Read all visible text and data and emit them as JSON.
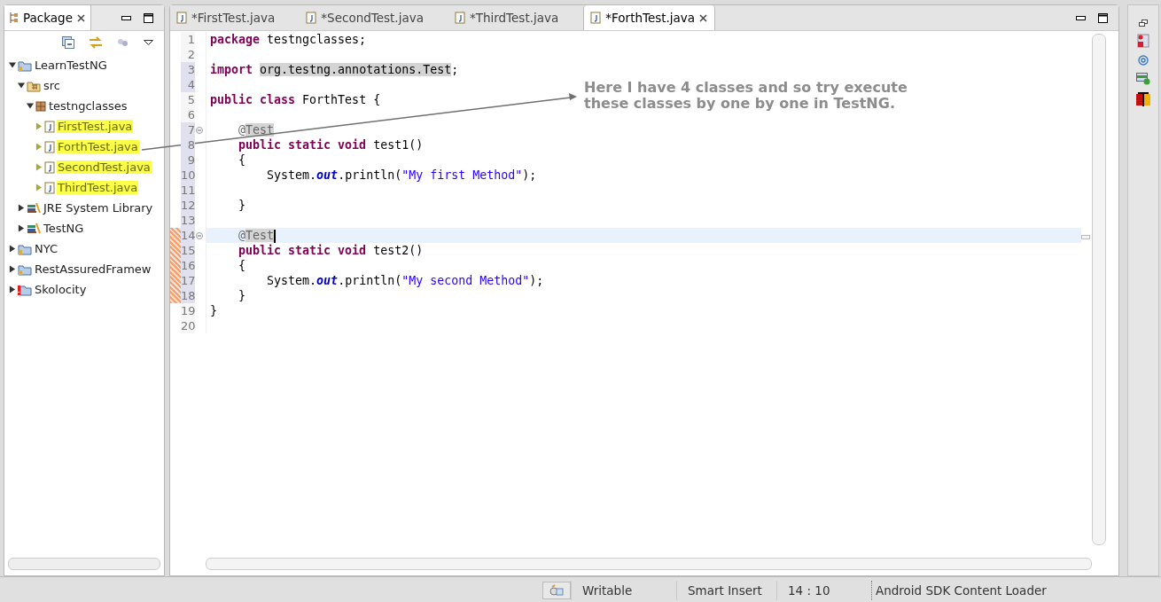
{
  "package_explorer": {
    "title": "Package",
    "tree": [
      {
        "label": "LearnTestNG",
        "kind": "project",
        "expanded": true,
        "children": [
          {
            "label": "src",
            "kind": "source-folder",
            "expanded": true,
            "children": [
              {
                "label": "testngclasses",
                "kind": "package",
                "expanded": true,
                "children": [
                  {
                    "label": "FirstTest.java",
                    "kind": "java-file",
                    "expanded": false,
                    "highlighted": true
                  },
                  {
                    "label": "ForthTest.java",
                    "kind": "java-file",
                    "expanded": false,
                    "highlighted": true
                  },
                  {
                    "label": "SecondTest.java",
                    "kind": "java-file",
                    "expanded": false,
                    "highlighted": true
                  },
                  {
                    "label": "ThirdTest.java",
                    "kind": "java-file",
                    "expanded": false,
                    "highlighted": true
                  }
                ]
              }
            ]
          },
          {
            "label": "JRE System Library",
            "kind": "library",
            "expanded": false,
            "highlighted": false
          },
          {
            "label": "TestNG",
            "kind": "library",
            "expanded": false,
            "highlighted": false
          }
        ]
      },
      {
        "label": "NYC",
        "kind": "project",
        "expanded": false,
        "highlighted": false
      },
      {
        "label": "RestAssuredFramew",
        "kind": "project",
        "expanded": false,
        "highlighted": false
      },
      {
        "label": "Skolocity",
        "kind": "error-project",
        "expanded": false,
        "highlighted": false
      }
    ]
  },
  "editor": {
    "tabs": [
      {
        "label": "*FirstTest.java",
        "selected": false
      },
      {
        "label": "*SecondTest.java",
        "selected": false
      },
      {
        "label": "*ThirdTest.java",
        "selected": false
      },
      {
        "label": "*ForthTest.java",
        "selected": true
      }
    ],
    "lines": [
      {
        "number": "1",
        "changed": false,
        "added": false,
        "tokens": [
          {
            "kind": "keyword",
            "text": "package"
          },
          {
            "kind": "plain",
            "text": " testngclasses;"
          }
        ]
      },
      {
        "number": "2",
        "changed": false,
        "added": false
      },
      {
        "number": "3",
        "changed": true,
        "added": false,
        "tokens": [
          {
            "kind": "keyword",
            "text": "import"
          },
          {
            "kind": "occurrence",
            "text": " org.testng.annotations.Test"
          },
          {
            "kind": "plain",
            "text": ";"
          }
        ]
      },
      {
        "number": "4",
        "changed": true,
        "added": false
      },
      {
        "number": "5",
        "changed": false,
        "added": false,
        "tokens": [
          {
            "kind": "keyword",
            "text": "public class"
          },
          {
            "kind": "plain",
            "text": " ForthTest {"
          }
        ]
      },
      {
        "number": "6",
        "changed": false,
        "added": false
      },
      {
        "number": "7",
        "changed": true,
        "added": false,
        "fold": true,
        "tokens": [
          {
            "kind": "annotation",
            "text": "    @Test"
          }
        ]
      },
      {
        "number": "8",
        "changed": true,
        "added": false,
        "tokens": [
          {
            "kind": "keyword",
            "text": "    public static void"
          },
          {
            "kind": "plain",
            "text": " test1()"
          }
        ]
      },
      {
        "number": "9",
        "changed": true,
        "added": false,
        "tokens": [
          {
            "kind": "plain",
            "text": "    {"
          }
        ]
      },
      {
        "number": "10",
        "changed": true,
        "added": false,
        "tokens": [
          {
            "kind": "plain",
            "text": "        System."
          },
          {
            "kind": "field",
            "text": "out"
          },
          {
            "kind": "plain",
            "text": ".println("
          },
          {
            "kind": "string",
            "text": "\"My first Method\""
          },
          {
            "kind": "plain",
            "text": ");"
          }
        ]
      },
      {
        "number": "11",
        "changed": true,
        "added": false
      },
      {
        "number": "12",
        "changed": true,
        "added": false,
        "tokens": [
          {
            "kind": "plain",
            "text": "    }"
          }
        ]
      },
      {
        "number": "13",
        "changed": true,
        "added": false
      },
      {
        "number": "14",
        "changed": true,
        "added": true,
        "fold": true,
        "current": true,
        "tokens": [
          {
            "kind": "annotation",
            "text": "    @Test"
          }
        ]
      },
      {
        "number": "15",
        "changed": true,
        "added": true,
        "tokens": [
          {
            "kind": "keyword",
            "text": "    public static void"
          },
          {
            "kind": "plain",
            "text": " test2()"
          }
        ]
      },
      {
        "number": "16",
        "changed": true,
        "added": true,
        "tokens": [
          {
            "kind": "plain",
            "text": "    {"
          }
        ]
      },
      {
        "number": "17",
        "changed": true,
        "added": true,
        "tokens": [
          {
            "kind": "plain",
            "text": "        System."
          },
          {
            "kind": "field",
            "text": "out"
          },
          {
            "kind": "plain",
            "text": ".println("
          },
          {
            "kind": "string",
            "text": "\"My second Method\""
          },
          {
            "kind": "plain",
            "text": ");"
          }
        ]
      },
      {
        "number": "18",
        "changed": true,
        "added": true,
        "tokens": [
          {
            "kind": "plain",
            "text": "    }"
          }
        ]
      },
      {
        "number": "19",
        "changed": false,
        "added": false,
        "tokens": [
          {
            "kind": "plain",
            "text": "}"
          }
        ]
      },
      {
        "number": "20",
        "changed": false,
        "added": false
      }
    ]
  },
  "note": {
    "lines": [
      "Here I have 4 classes and so try execute",
      "these classes by one by one in TestNG."
    ]
  },
  "status_bar": {
    "items": [
      "Writable",
      "Smart Insert",
      "14 : 10"
    ],
    "job": "Android SDK Content Loader"
  }
}
